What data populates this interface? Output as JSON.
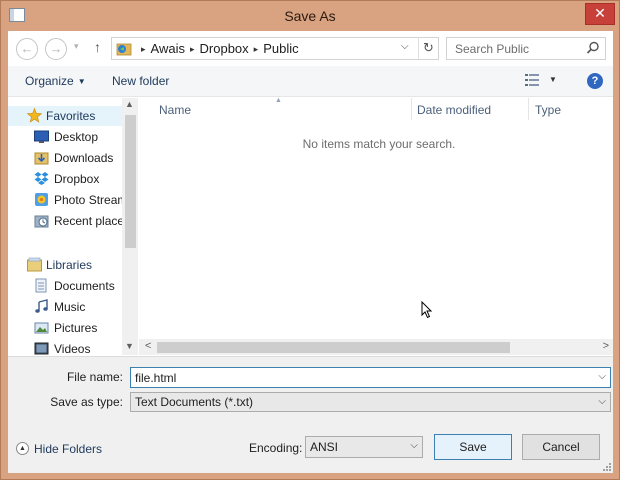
{
  "window": {
    "title": "Save As",
    "close_label": "✕"
  },
  "nav": {
    "back_glyph": "←",
    "forward_glyph": "→",
    "history_glyph": "▾",
    "up_glyph": "↑",
    "path": [
      "Awais",
      "Dropbox",
      "Public"
    ],
    "path_sep": "▸",
    "address_drop_glyph": "⌵",
    "refresh_glyph": "↻",
    "search_placeholder": "Search Public"
  },
  "toolbar": {
    "organize_label": "Organize",
    "organize_caret": "▼",
    "new_folder_label": "New folder",
    "view_caret": "▼",
    "help_label": "?"
  },
  "navpane": {
    "items": [
      {
        "label": "Favorites",
        "icon": "star-icon",
        "group": true
      },
      {
        "label": "Desktop",
        "icon": "desktop-icon"
      },
      {
        "label": "Downloads",
        "icon": "downloads-icon"
      },
      {
        "label": "Dropbox",
        "icon": "dropbox-icon"
      },
      {
        "label": "Photo Stream",
        "icon": "photo-stream-icon"
      },
      {
        "label": "Recent places",
        "icon": "recent-places-icon"
      },
      {
        "label": "Libraries",
        "icon": "libraries-icon",
        "group": true
      },
      {
        "label": "Documents",
        "icon": "documents-icon"
      },
      {
        "label": "Music",
        "icon": "music-icon"
      },
      {
        "label": "Pictures",
        "icon": "pictures-icon"
      },
      {
        "label": "Videos",
        "icon": "videos-icon"
      }
    ],
    "scroll_up_glyph": "▲",
    "scroll_down_glyph": "▼"
  },
  "filelist": {
    "columns": [
      "Name",
      "Date modified",
      "Type"
    ],
    "sort_glyph": "▲",
    "empty_message": "No items match your search.",
    "scroll_left_glyph": "<",
    "scroll_right_glyph": ">"
  },
  "form": {
    "file_name_label": "File name:",
    "file_name_value": "file.html",
    "save_type_label": "Save as type:",
    "save_type_value": "Text Documents (*.txt)",
    "dropdown_glyph": "⌵",
    "hide_folders_label": "Hide Folders",
    "hide_folders_glyph": "▲",
    "encoding_label": "Encoding:",
    "encoding_value": "ANSI",
    "save_label": "Save",
    "cancel_label": "Cancel"
  },
  "colors": {
    "title_bar": "#d9a382",
    "close_button": "#c7403a",
    "link_text": "#1e395b",
    "focus_border": "#3c7fb1"
  }
}
